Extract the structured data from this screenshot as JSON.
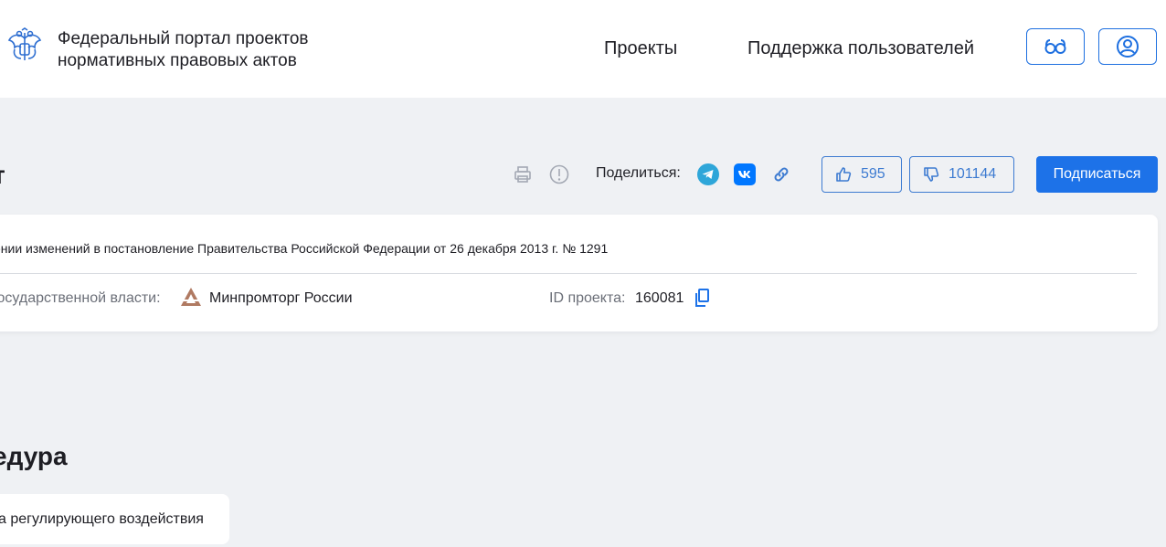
{
  "header": {
    "portal_title_line1": "Федеральный портал проектов",
    "portal_title_line2": "нормативных правовых актов",
    "nav": [
      "Проекты",
      "Поддержка пользователей"
    ]
  },
  "project": {
    "section_title": "кт",
    "share_label": "Поделиться:",
    "likes": "595",
    "dislikes": "101144",
    "subscribe_label": "Подписаться",
    "title": "ении изменений в постановление Правительства Российской Федерации от 26 декабря 2013 г. № 1291",
    "dept_label": "государственной власти:",
    "dept_name": "Минпромторг России",
    "id_label": "ID проекта:",
    "id_value": "160081"
  },
  "procedure": {
    "section_title": "едура",
    "stage": "а регулирующего воздействия"
  },
  "colors": {
    "accent": "#1d72e8",
    "outline": "#3d7bd1",
    "background": "#eff1f4",
    "telegram": "#2ea6d9",
    "vk": "#0077ff"
  },
  "icons": [
    "emblem-icon",
    "glasses-icon",
    "user-icon",
    "print-icon",
    "alert-icon",
    "telegram-icon",
    "vk-icon",
    "link-icon",
    "thumbs-up-icon",
    "thumbs-down-icon",
    "ministry-logo-icon",
    "copy-icon"
  ]
}
